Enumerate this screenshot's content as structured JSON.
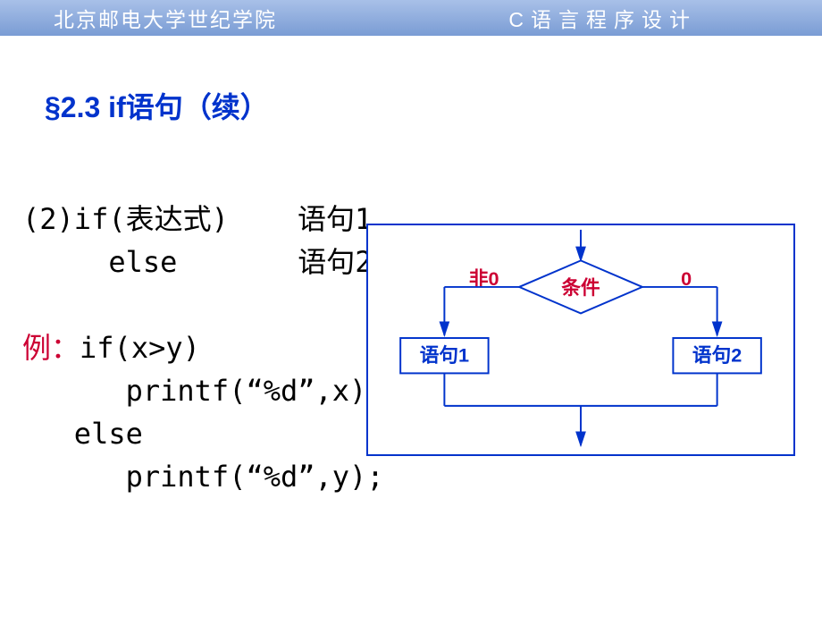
{
  "header": {
    "left": "北京邮电大学世纪学院",
    "right": "C语言程序设计"
  },
  "section_title": "§2.3 if语句（续）",
  "syntax": {
    "line1_prefix": "(2)if(表达式)",
    "line1_suffix": "语句1",
    "line2_prefix": "else",
    "line2_suffix": "语句2"
  },
  "example": {
    "label": "例：",
    "line1": "if(x>y)",
    "line2": "printf(“%d”,x);",
    "line3": "else",
    "line4": "printf(“%d”,y);"
  },
  "flowchart": {
    "nonzero_label": "非0",
    "zero_label": "0",
    "condition": "条件",
    "stmt1": "语句1",
    "stmt2": "语句2"
  }
}
